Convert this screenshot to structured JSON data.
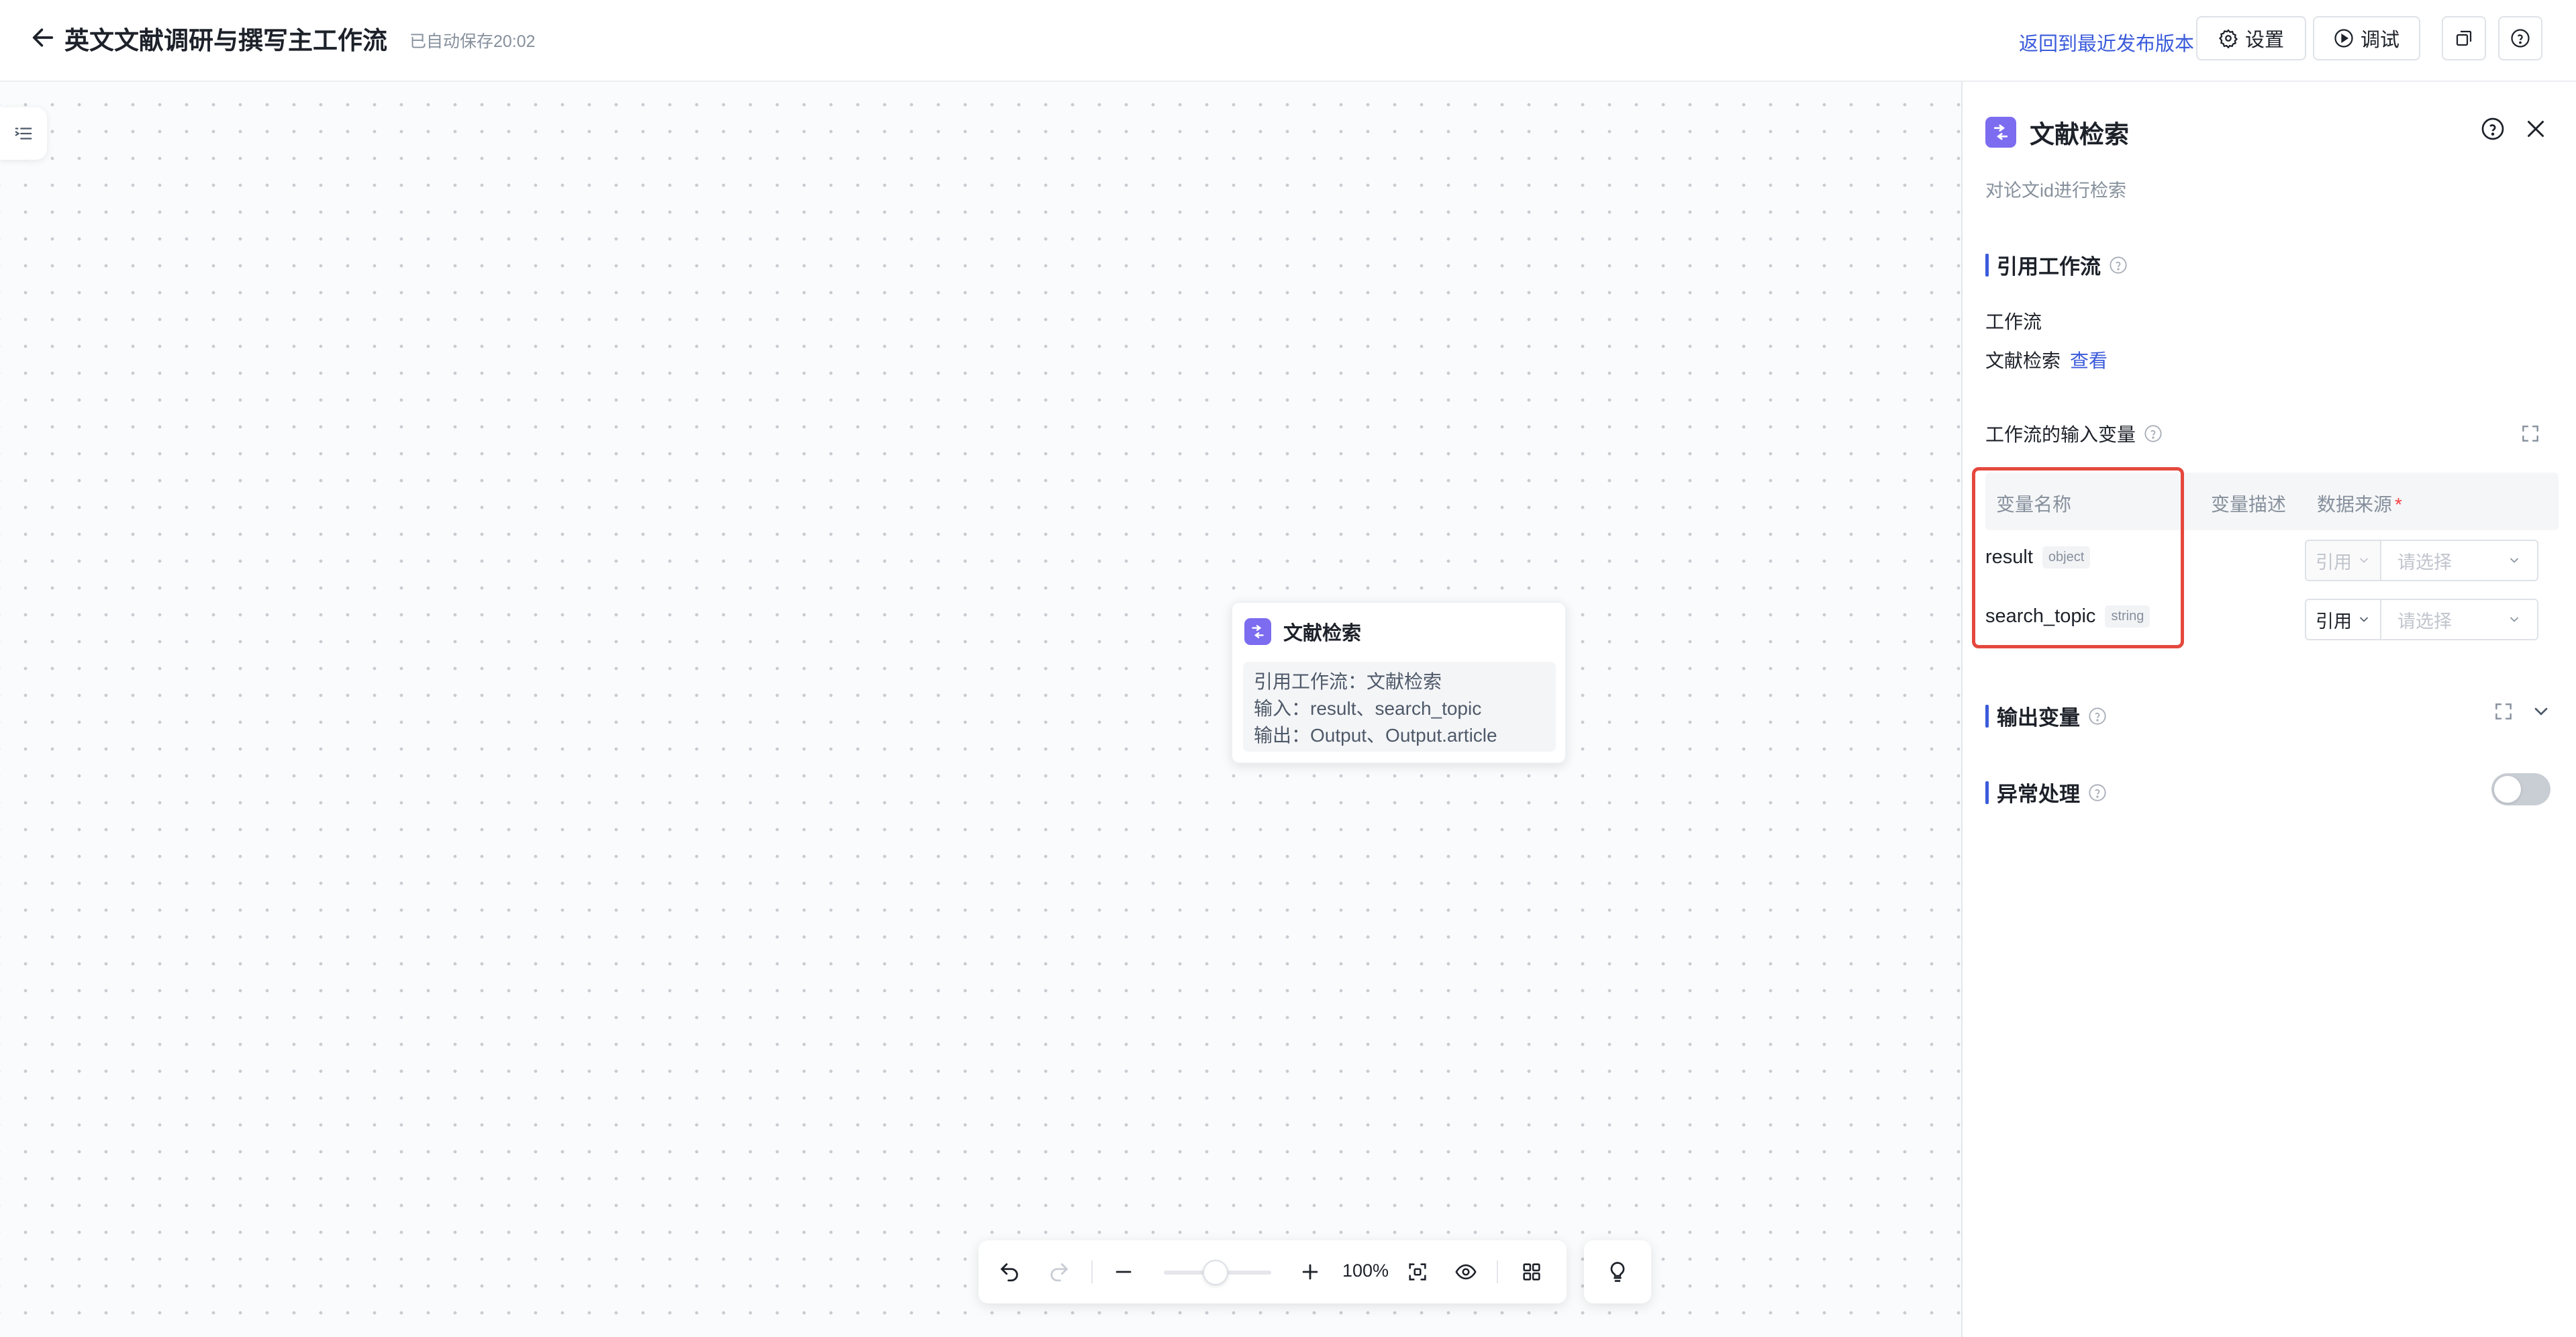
{
  "header": {
    "title": "英文文献调研与撰写主工作流",
    "autosave": "已自动保存20:02",
    "back_icon": "arrow-left-icon",
    "restore_link": "返回到最近发布版本",
    "settings_label": "设置",
    "debug_label": "调试"
  },
  "node": {
    "title": "文献检索",
    "lines": [
      "引用工作流：文献检索",
      "输入：result、search_topic",
      "输出：Output、Output.article"
    ]
  },
  "toolbar": {
    "zoom": "100%",
    "zoom_level": 0.5
  },
  "panel": {
    "title": "文献检索",
    "description": "对论文id进行检索",
    "ref_section": "引用工作流",
    "workflow_label": "工作流",
    "workflow_name": "文献检索",
    "view_link": "查看",
    "inputs_section": "工作流的输入变量",
    "columns": [
      "变量名称",
      "变量描述",
      "数据来源"
    ],
    "required_mark": "*",
    "rows": [
      {
        "name": "result",
        "type": "object",
        "source": "引用",
        "placeholder": "请选择",
        "source_disabled": true
      },
      {
        "name": "search_topic",
        "type": "string",
        "source": "引用",
        "placeholder": "请选择",
        "source_disabled": false
      }
    ],
    "outputs_section": "输出变量",
    "error_section": "异常处理",
    "error_enabled": false
  },
  "colors": {
    "accent": "#3b5bdb",
    "node_icon": "#7c6cf0",
    "highlight": "#e5483d"
  }
}
